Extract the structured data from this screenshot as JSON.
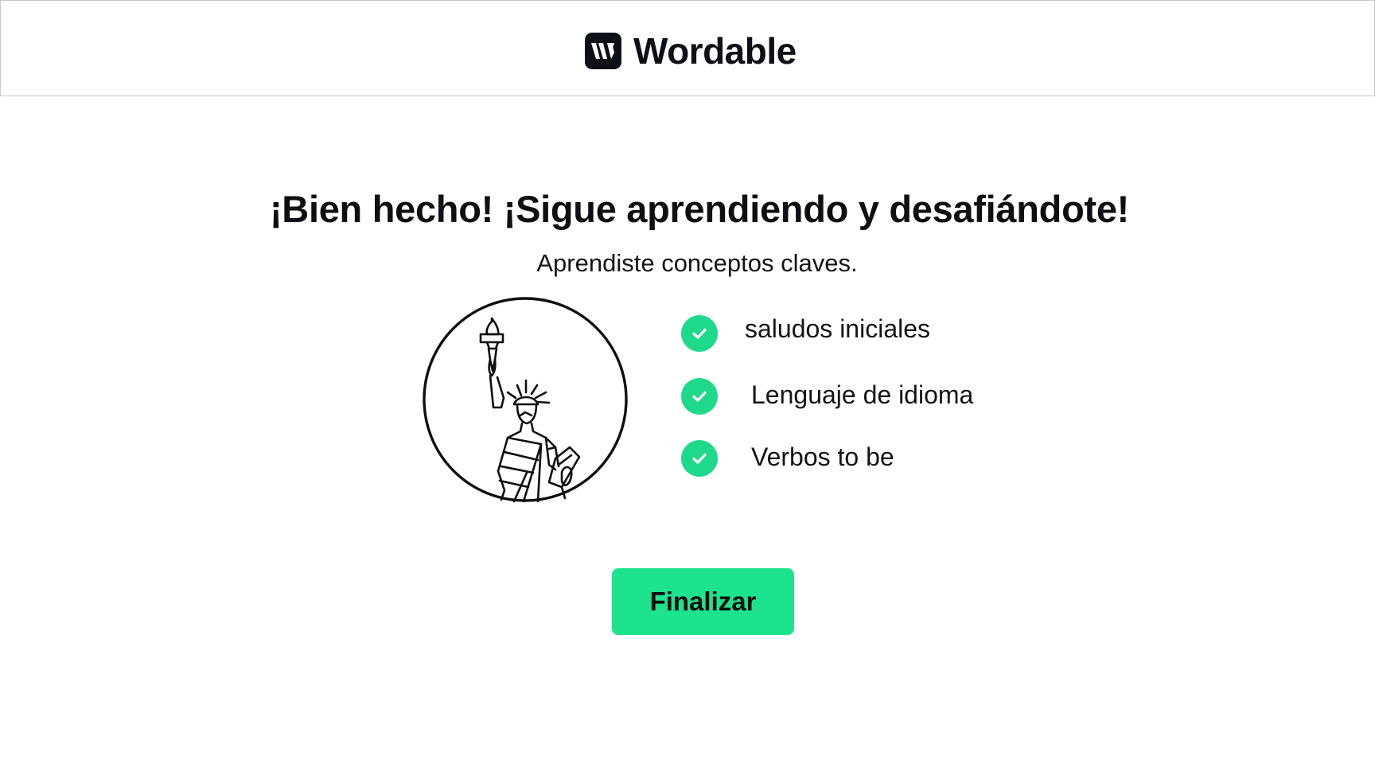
{
  "header": {
    "brand_name": "Wordable",
    "logo_icon": "wordable-logo-icon"
  },
  "completion": {
    "title": "¡Bien hecho! ¡Sigue aprendiendo y desafiándote!",
    "subtitle": "Aprendiste conceptos claves.",
    "illustration_icon": "statue-of-liberty-icon",
    "concepts": [
      {
        "label": "saludos iniciales",
        "icon": "check-circle-icon"
      },
      {
        "label": "Lenguaje de idioma",
        "icon": "check-circle-icon"
      },
      {
        "label": "Verbos to be",
        "icon": "check-circle-icon"
      }
    ],
    "finish_label": "Finalizar"
  },
  "colors": {
    "accent": "#1ee38e",
    "check": "#1fd98a",
    "text": "#0d0f12",
    "logo_bg": "#0d1117",
    "border": "#c9c9c9"
  }
}
